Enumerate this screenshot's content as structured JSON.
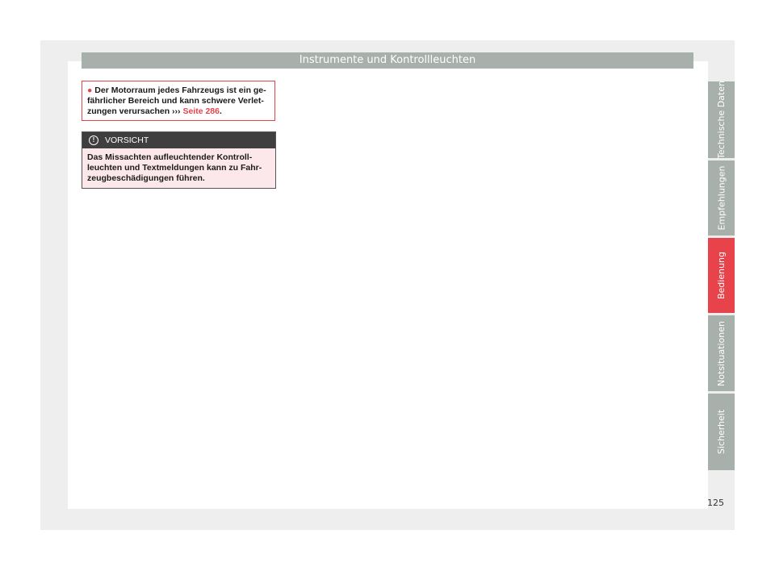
{
  "header": {
    "title": "Instrumente und Kontrollleuchten"
  },
  "warning": {
    "bullet": "●",
    "line1": "Der Motorraum jedes Fahrzeugs ist ein ge-",
    "line2": "fährlicher Bereich und kann schwere Verlet-",
    "line3_prefix": "zungen verursachen ",
    "arrow": "›››",
    "link": " Seite 286",
    "period": "."
  },
  "caution": {
    "icon": "!",
    "title": "VORSICHT",
    "line1": "Das Missachten aufleuchtender Kontroll-",
    "line2": "leuchten und Textmeldungen kann zu Fahr-",
    "line3": "zeugbeschädigungen führen."
  },
  "side_tabs": [
    {
      "label": "Technische Daten"
    },
    {
      "label": "Empfehlungen"
    },
    {
      "label": "Bedienung"
    },
    {
      "label": "Notsituationen"
    },
    {
      "label": "Sicherheit"
    }
  ],
  "page_number": "125",
  "colors": {
    "accent": "#e8424b",
    "tab_gray": "#a7b0ab",
    "caution_head": "#3f3f3f"
  }
}
